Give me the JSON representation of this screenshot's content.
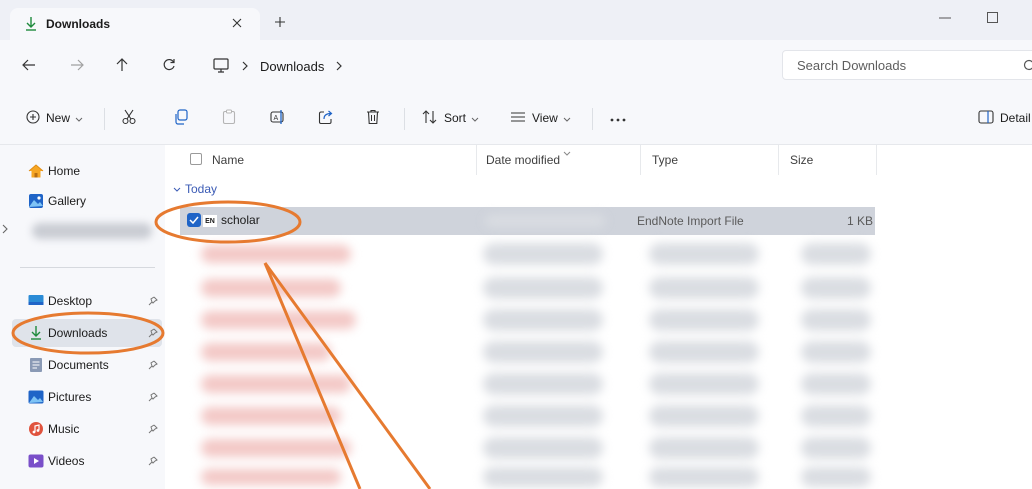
{
  "tab": {
    "title": "Downloads"
  },
  "address": {
    "crumbs": [
      "Downloads"
    ]
  },
  "search": {
    "placeholder": "Search Downloads"
  },
  "toolbar": {
    "new_label": "New",
    "sort_label": "Sort",
    "view_label": "View",
    "details_label": "Detail"
  },
  "sidebar": {
    "items": [
      {
        "label": "Home",
        "icon": "home-icon"
      },
      {
        "label": "Gallery",
        "icon": "gallery-icon"
      },
      {
        "label": "Desktop",
        "icon": "desktop-icon"
      },
      {
        "label": "Downloads",
        "icon": "downloads-icon"
      },
      {
        "label": "Documents",
        "icon": "documents-icon"
      },
      {
        "label": "Pictures",
        "icon": "pictures-icon"
      },
      {
        "label": "Music",
        "icon": "music-icon"
      },
      {
        "label": "Videos",
        "icon": "videos-icon"
      }
    ]
  },
  "columns": {
    "name": "Name",
    "date": "Date modified",
    "type": "Type",
    "size": "Size"
  },
  "group": {
    "label": "Today"
  },
  "selected_file": {
    "name": "scholar",
    "icon_text": "EN",
    "type": "EndNote Import File",
    "size": "1 KB"
  },
  "colors": {
    "accent": "#1f64c7",
    "annotation": "#e67a30",
    "group_text": "#3b5bb5"
  }
}
